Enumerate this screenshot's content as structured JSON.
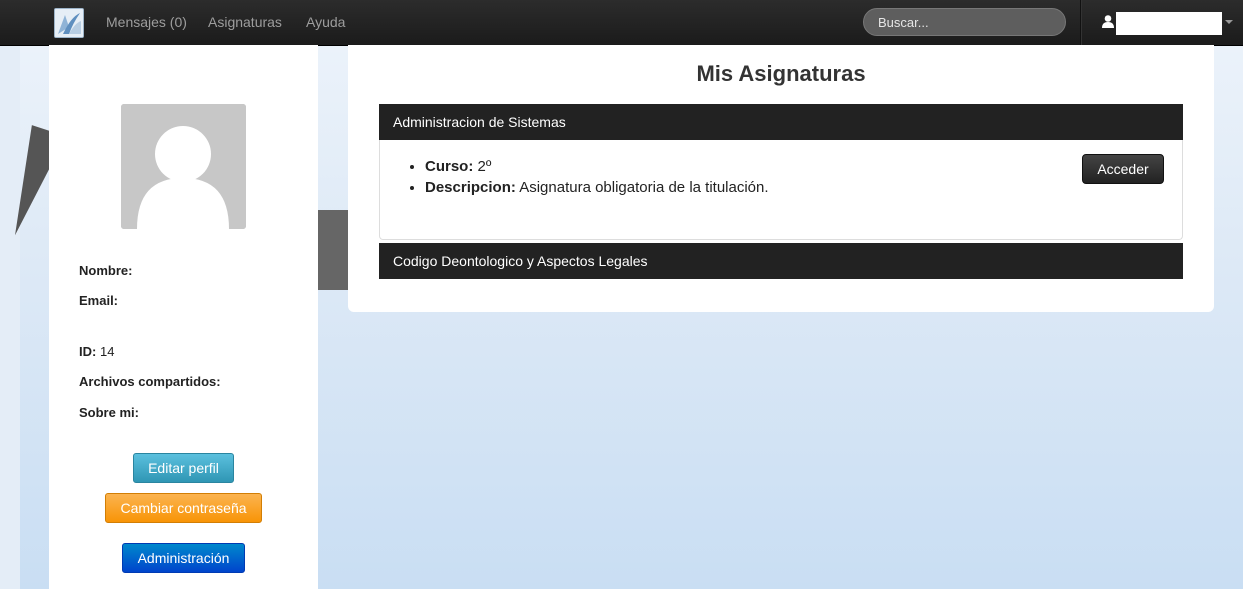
{
  "navbar": {
    "mensajes": "Mensajes (0)",
    "asignaturas": "Asignaturas",
    "ayuda": "Ayuda",
    "search_placeholder": "Buscar...",
    "user_icon": "user-icon",
    "caret_icon": "caret-down-icon"
  },
  "profile": {
    "nombre_label": "Nombre:",
    "email_label": "Email:",
    "id_label": "ID:",
    "id_value": "14",
    "archivos_label": "Archivos compartidos:",
    "sobre_label": "Sobre mi:",
    "edit_button": "Editar perfil",
    "password_button": "Cambiar contraseña",
    "admin_button": "Administración"
  },
  "main": {
    "title": "Mis Asignaturas",
    "subjects": [
      {
        "name": "Administracion de Sistemas",
        "curso_label": "Curso:",
        "curso_value": "2º",
        "descripcion_label": "Descripcion:",
        "descripcion_value": "Asignatura obligatoria de la titulación.",
        "access_button": "Acceder"
      },
      {
        "name": "Codigo Deontologico y Aspectos Legales"
      }
    ]
  },
  "colors": {
    "navbar": "#1b1b1b",
    "edit_button": "#2f96b4",
    "password_button": "#f89406",
    "admin_button": "#0044cc",
    "accordion_header": "#222222"
  }
}
